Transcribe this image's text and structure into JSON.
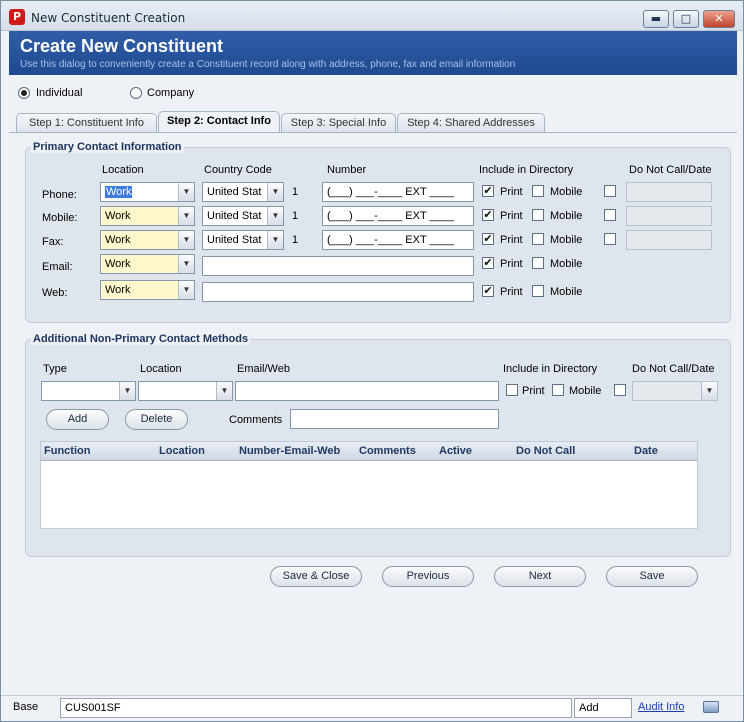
{
  "window": {
    "title": "New Constituent Creation",
    "app_icon": "P",
    "minimize": "▬",
    "maximize": "□",
    "close": "✕"
  },
  "banner": {
    "title": "Create New Constituent",
    "subtitle": "Use this dialog to conveniently create a Constituent record along with address, phone, fax and email information"
  },
  "type_options": {
    "individual": "Individual",
    "company": "Company",
    "selected": "individual"
  },
  "tabs": [
    {
      "label": "Step 1: Constituent Info",
      "active": false
    },
    {
      "label": "Step 2: Contact Info",
      "active": true
    },
    {
      "label": "Step 3: Special Info",
      "active": false
    },
    {
      "label": "Step 4: Shared Addresses",
      "active": false
    }
  ],
  "primary": {
    "title": "Primary Contact Information",
    "headers": {
      "location": "Location",
      "country": "Country Code",
      "number": "Number",
      "directory": "Include in Directory",
      "dnc": "Do Not Call/Date"
    },
    "print_label": "Print",
    "mobile_label": "Mobile",
    "rows": [
      {
        "label": "Phone:",
        "location": "Work",
        "country": "United Stat",
        "code": "1",
        "number": "(___) ___-____ EXT ____",
        "print": "✔",
        "mobile": "",
        "dnc": ""
      },
      {
        "label": "Mobile:",
        "location": "Work",
        "country": "United Stat",
        "code": "1",
        "number": "(___) ___-____ EXT ____",
        "print": "✔",
        "mobile": "",
        "dnc": ""
      },
      {
        "label": "Fax:",
        "location": "Work",
        "country": "United Stat",
        "code": "1",
        "number": "(___) ___-____ EXT ____",
        "print": "✔",
        "mobile": "",
        "dnc": ""
      },
      {
        "label": "Email:",
        "location": "Work",
        "value": "",
        "print": "✔",
        "mobile": ""
      },
      {
        "label": "Web:",
        "location": "Work",
        "value": "",
        "print": "✔",
        "mobile": ""
      }
    ]
  },
  "additional": {
    "title": "Additional Non-Primary Contact Methods",
    "headers": {
      "type": "Type",
      "location": "Location",
      "email_web": "Email/Web",
      "directory": "Include in Directory",
      "dnc": "Do Not Call/Date"
    },
    "print_label": "Print",
    "mobile_label": "Mobile",
    "add_label": "Add",
    "delete_label": "Delete",
    "comments_label": "Comments",
    "columns": [
      "Function",
      "Location",
      "Number-Email-Web",
      "Comments",
      "Active",
      "Do Not Call",
      "Date"
    ]
  },
  "footer": {
    "save_close": "Save & Close",
    "previous": "Previous",
    "next": "Next",
    "save": "Save"
  },
  "status": {
    "left": "Base",
    "code": "CUS001SF",
    "mode": "Add",
    "audit": "Audit Info"
  }
}
